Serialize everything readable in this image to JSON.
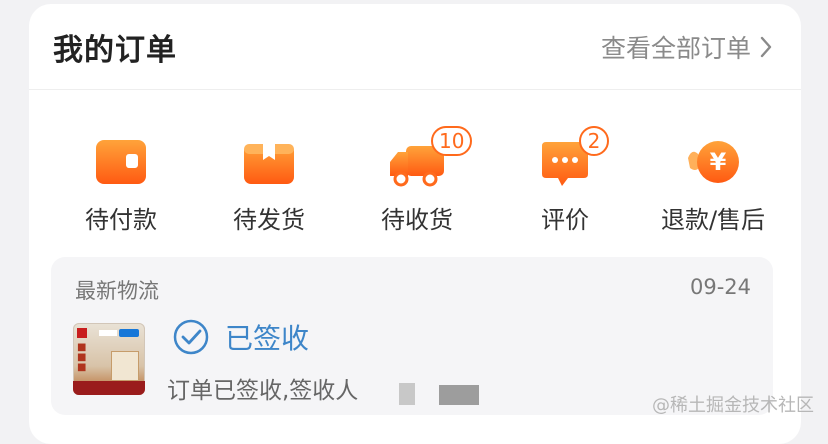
{
  "header": {
    "title": "我的订单",
    "view_all": "查看全部订单"
  },
  "orders": [
    {
      "label": "待付款",
      "icon": "wallet-icon"
    },
    {
      "label": "待发货",
      "icon": "box-icon"
    },
    {
      "label": "待收货",
      "icon": "truck-icon",
      "badge": "10"
    },
    {
      "label": "评价",
      "icon": "comment-icon",
      "badge": "2"
    },
    {
      "label": "退款/售后",
      "icon": "refund-icon"
    }
  ],
  "logistics": {
    "title": "最新物流",
    "date": "09-24",
    "status": "已签收",
    "detail": "订单已签收,签收人"
  },
  "watermark": "@稀土掘金技术社区",
  "colors": {
    "accent": "#ff7a1a",
    "status_blue": "#3e86c9"
  }
}
